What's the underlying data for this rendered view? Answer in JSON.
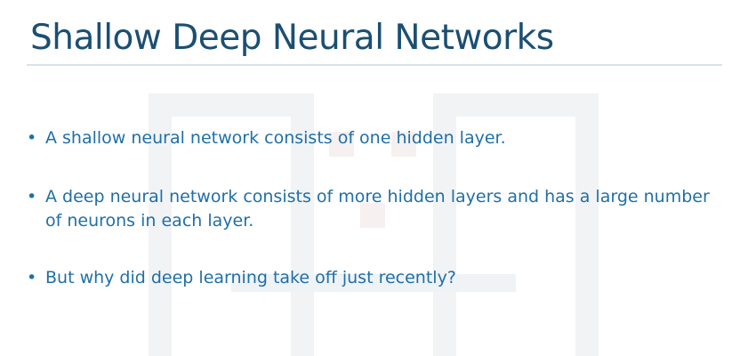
{
  "slide": {
    "title": "Shallow Deep Neural Networks",
    "bullets": [
      {
        "marker": "•",
        "text": "A shallow neural network consists of one hidden layer."
      },
      {
        "marker": "•",
        "text": "A deep neural network consists of more hidden layers and has a large number of neurons in each layer."
      },
      {
        "marker": "•",
        "text": "But why did deep learning take off just recently?"
      }
    ]
  },
  "colors": {
    "title": "#1b4f72",
    "bullet_text": "#1f6fa8",
    "rule": "#d6e3ea",
    "background": "#ffffff"
  },
  "icons": {
    "watermark": "faded-logo-watermark-icon"
  }
}
